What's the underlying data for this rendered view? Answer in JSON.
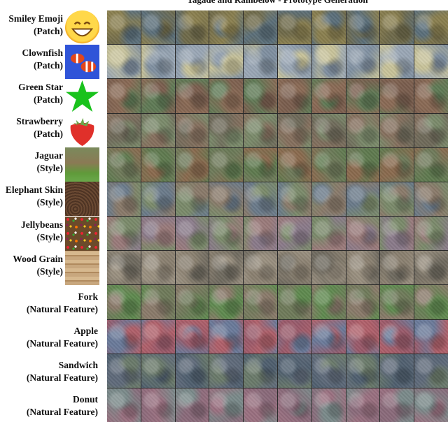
{
  "title": "Tagade and Rainbelow - Prototype Generation",
  "rows": [
    {
      "name": "Smiley Emoji",
      "type": "(Patch)",
      "thumbnail": "smiley-emoji-image",
      "palette": [
        "#6f6a4a",
        "#8a7f4f",
        "#5b6f7a"
      ]
    },
    {
      "name": "Clownfish",
      "type": "(Patch)",
      "thumbnail": "clownfish-image",
      "palette": [
        "#9aa7b5",
        "#c8c39a",
        "#7f8fa0"
      ]
    },
    {
      "name": "Green Star",
      "type": "(Patch)",
      "thumbnail": "green-star-image",
      "palette": [
        "#7a5e4e",
        "#8a6a55",
        "#5f7a55"
      ]
    },
    {
      "name": "Strawberry",
      "type": "(Patch)",
      "thumbnail": "strawberry-image",
      "palette": [
        "#86705e",
        "#6f6a5a",
        "#7a8a6a"
      ]
    },
    {
      "name": "Jaguar",
      "type": "(Style)",
      "thumbnail": "jaguar-image",
      "palette": [
        "#8a6a4e",
        "#6f7a5a",
        "#5f7a4f"
      ]
    },
    {
      "name": "Elephant Skin",
      "type": "(Style)",
      "thumbnail": "elephant-skin-image",
      "palette": [
        "#7a8a6a",
        "#8a7a6a",
        "#6a7a8a"
      ]
    },
    {
      "name": "Jellybeans",
      "type": "(Style)",
      "thumbnail": "jellybeans-image",
      "palette": [
        "#8a7a8a",
        "#7a8a6a",
        "#9a7a7a"
      ]
    },
    {
      "name": "Wood Grain",
      "type": "(Style)",
      "thumbnail": "wood-grain-image",
      "palette": [
        "#8a8070",
        "#6f6a5f",
        "#9a9080"
      ]
    },
    {
      "name": "Fork",
      "type": "(Natural Feature)",
      "thumbnail": null,
      "palette": [
        "#6f7a5a",
        "#5f8a4f",
        "#8a7a6a"
      ]
    },
    {
      "name": "Apple",
      "type": "(Natural Feature)",
      "thumbnail": null,
      "palette": [
        "#9a5a6a",
        "#6a7a9a",
        "#b0606a"
      ]
    },
    {
      "name": "Sandwich",
      "type": "(Natural Feature)",
      "thumbnail": null,
      "palette": [
        "#4f5f6f",
        "#5f6a7a",
        "#6a7a6a"
      ]
    },
    {
      "name": "Donut",
      "type": "(Natural Feature)",
      "thumbnail": null,
      "palette": [
        "#8a6a7a",
        "#7a8a8a",
        "#9a7080"
      ]
    }
  ],
  "grid": {
    "columns": 10
  }
}
